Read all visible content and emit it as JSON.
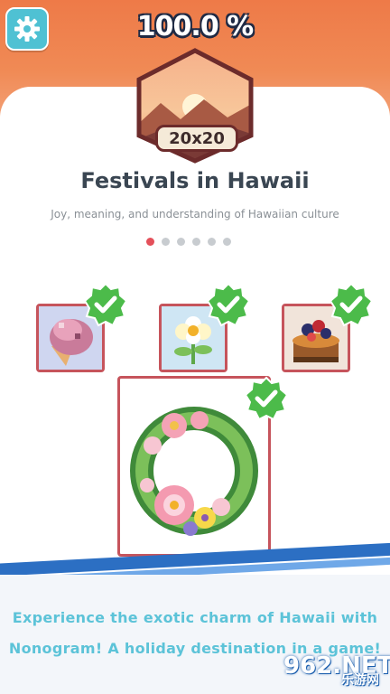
{
  "header": {
    "progress_text": "100.0 %",
    "settings_icon": "gear-icon",
    "puzzle_size": "20x20"
  },
  "collection": {
    "title": "Festivals in Hawaii",
    "subtitle": "Joy, meaning, and understanding of Hawaiian culture",
    "page_dots": 6,
    "active_page": 0
  },
  "puzzles": [
    {
      "name": "ice-cream",
      "completed": true
    },
    {
      "name": "flower",
      "completed": true
    },
    {
      "name": "fruit-tart",
      "completed": true
    },
    {
      "name": "flower-wreath",
      "completed": true
    }
  ],
  "promo": {
    "line1": "Experience the exotic charm of Hawaii with",
    "line2": "Nonogram! A holiday destination in a game!"
  },
  "watermark": {
    "text": "962.NET",
    "cn": "乐游网"
  },
  "colors": {
    "accent_orange": "#ee7a48",
    "settings_teal": "#4fc1d3",
    "tile_border": "#c6545c",
    "check_green": "#4cbb4a",
    "active_dot": "#e4505a",
    "promo_text": "#5cc3d8"
  }
}
